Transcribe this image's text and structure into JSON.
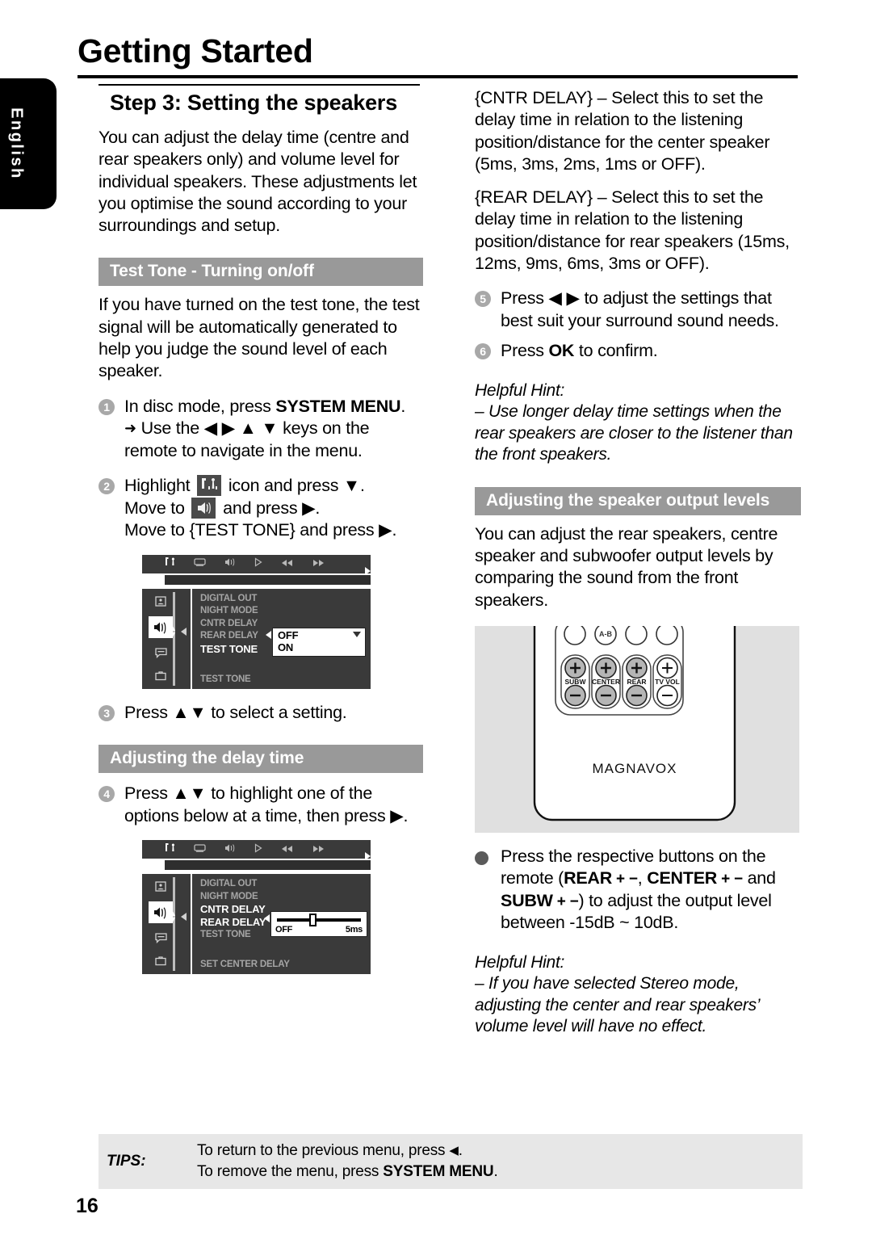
{
  "language_tab": {
    "label": "English"
  },
  "header": {
    "title": "Getting Started"
  },
  "left_column": {
    "step_heading": "Step 3:  Setting the speakers",
    "intro": "You can adjust the delay time (centre and rear speakers only) and volume level for individual speakers.  These adjustments let you optimise the sound according to your surroundings and setup.",
    "section_test_tone": "Test Tone - Turning on/off",
    "test_tone_body": "If you have turned on the test tone, the test signal will be automatically generated to help you judge the sound level of each speaker.",
    "step1": {
      "num": "1",
      "line1_pre": "In disc mode, press ",
      "line1_bold": "SYSTEM MENU",
      "line1_post": ".",
      "line2_arrow": "➜",
      "line2": "Use the ◀ ▶ ▲ ▼ keys on the remote to navigate in the menu."
    },
    "step2": {
      "num": "2",
      "line1_pre": "Highlight ",
      "line1_icon": "tools-icon",
      "line1_post": " icon and press ▼.",
      "line2_pre": "Move to ",
      "line2_icon": "speaker-icon",
      "line2_post": " and press ▶.",
      "line3": "Move to {TEST TONE} and press ▶."
    },
    "osd_test_tone": {
      "toolbar_icons": [
        "tools-icon",
        "display-icon",
        "audio-icon",
        "play-icon",
        "rewind-icon",
        "fastforward-icon"
      ],
      "rail_icons": [
        "picture-icon",
        "speaker-icon",
        "subtitle-icon",
        "preference-icon"
      ],
      "rail_selected_index": 1,
      "items": [
        "DIGITAL OUT",
        "NIGHT MODE",
        "CNTR DELAY",
        "REAR DELAY",
        "TEST TONE"
      ],
      "highlighted_item": "TEST TONE",
      "footer": "TEST TONE",
      "popup_options": [
        "OFF",
        "ON"
      ]
    },
    "step3": {
      "num": "3",
      "text": "Press ▲▼ to select a setting."
    },
    "section_delay": "Adjusting the delay time",
    "step4": {
      "num": "4",
      "text": "Press ▲▼ to highlight one of the options below at a time, then press ▶."
    },
    "osd_delay": {
      "toolbar_icons": [
        "tools-icon",
        "display-icon",
        "audio-icon",
        "play-icon",
        "rewind-icon",
        "fastforward-icon"
      ],
      "rail_icons": [
        "picture-icon",
        "speaker-icon",
        "subtitle-icon",
        "preference-icon"
      ],
      "rail_selected_index": 1,
      "items": [
        "DIGITAL OUT",
        "NIGHT MODE",
        "CNTR DELAY",
        "REAR DELAY",
        "TEST TONE"
      ],
      "highlighted_items": [
        "CNTR DELAY",
        "REAR DELAY"
      ],
      "footer": "SET CENTER DELAY",
      "slider": {
        "min_label": "OFF",
        "max_label": "5ms",
        "position_percent": 38
      }
    }
  },
  "right_column": {
    "cntr_delay_para": "{CNTR DELAY} – Select this to set the delay time in relation to the listening position/distance for the center speaker (5ms, 3ms, 2ms, 1ms or OFF).",
    "rear_delay_para": "{REAR DELAY} – Select this to set the delay time in relation to the listening position/distance for rear speakers (15ms, 12ms, 9ms, 6ms, 3ms or OFF).",
    "step5": {
      "num": "5",
      "text": "Press ◀ ▶  to adjust the settings that best suit your surround sound needs."
    },
    "step6": {
      "num": "6",
      "pre": "Press ",
      "bold": "OK",
      "post": " to confirm."
    },
    "hint1": {
      "title": "Helpful Hint:",
      "text": "–  Use longer delay time settings when the rear speakers are closer to the listener than the front speakers."
    },
    "section_output_levels": "Adjusting the speaker output levels",
    "output_levels_body": "You can adjust the rear speakers, centre speaker and subwoofer output levels by comparing the sound from the front speakers.",
    "remote": {
      "brand": "MAGNAVOX",
      "ab_label": "A-B",
      "button_groups": [
        {
          "label": "SUBW",
          "filled": true
        },
        {
          "label": "CENTER",
          "filled": true
        },
        {
          "label": "REAR",
          "filled": true
        },
        {
          "label": "TV VOL",
          "filled": false
        }
      ],
      "plus": "+",
      "minus": "−"
    },
    "bullet_step": {
      "pre": "Press the respective buttons on the remote (",
      "b1": "REAR",
      "pm1": " + −",
      "sep1": ", ",
      "b2": "CENTER",
      "pm2": " + −",
      "mid": " and ",
      "b3": "SUBW",
      "pm3": " + −",
      "post": ") to adjust the output level between -15dB ~ 10dB."
    },
    "hint2": {
      "title": "Helpful Hint:",
      "text": "–  If you have selected Stereo mode, adjusting the center and rear speakers’ volume level will have no effect."
    }
  },
  "footer": {
    "tips_label": "TIPS:",
    "tips_line1_pre": "To return to the previous menu, press ",
    "tips_line1_glyph": "◀",
    "tips_line1_post": ".",
    "tips_line2_pre": "To remove the menu, press ",
    "tips_line2_bold": "SYSTEM MENU",
    "tips_line2_post": ".",
    "page_number": "16"
  },
  "colors": {
    "section_header_bg": "#999999",
    "tips_bg": "#e7e7e7",
    "osd_bg": "#3a3a3a",
    "remote_bg": "#e0e0e0",
    "step_num_bg": "#a8a8a8"
  }
}
